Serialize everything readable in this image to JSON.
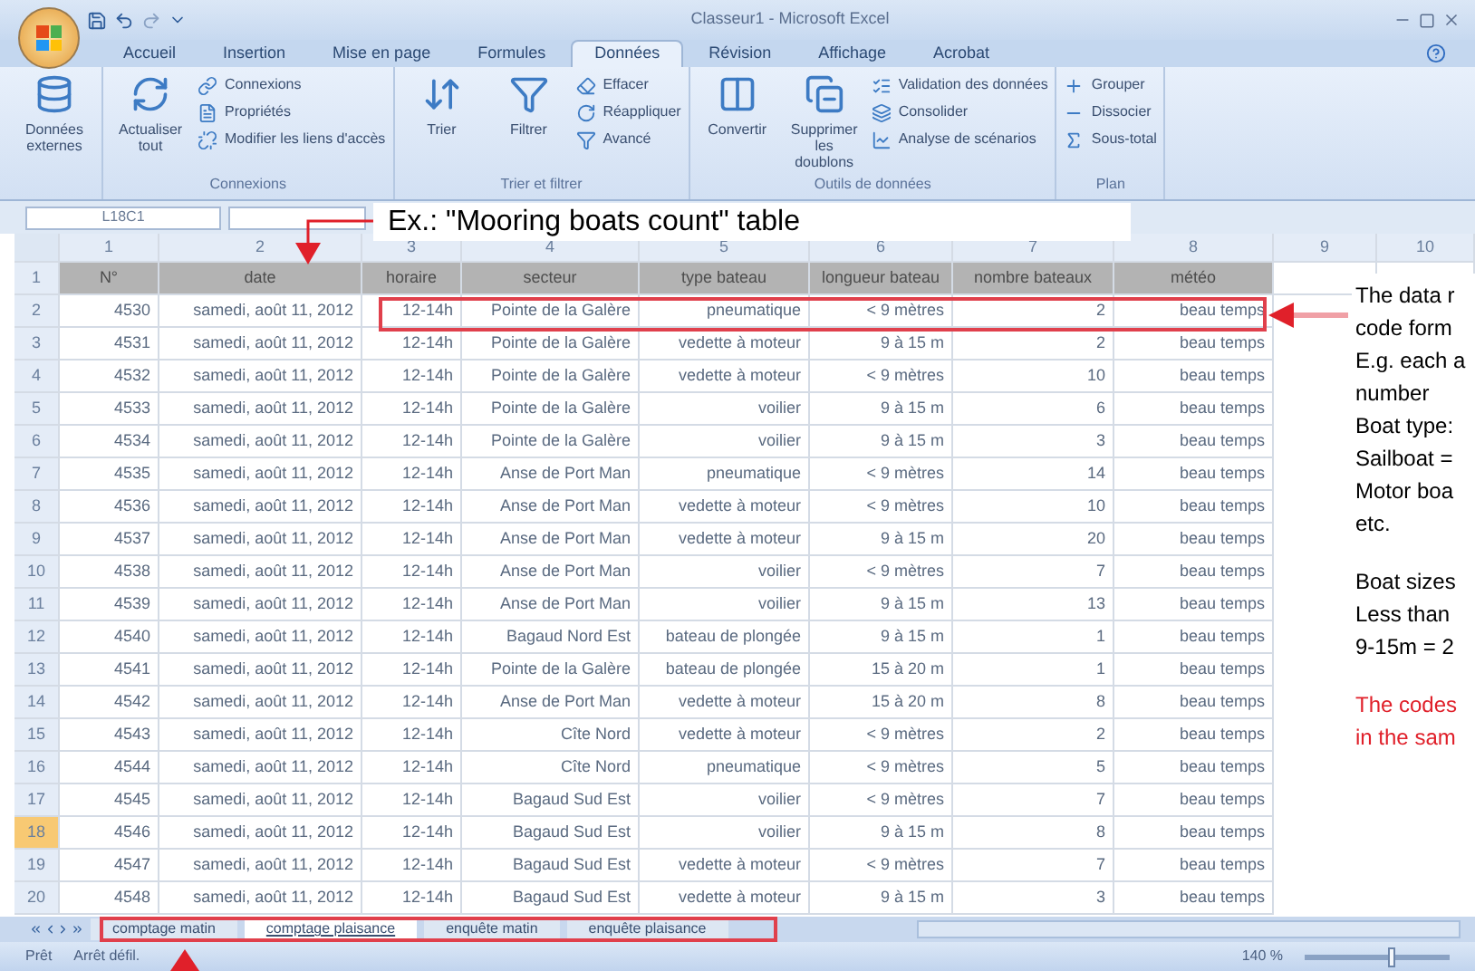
{
  "window": {
    "title": "Classeur1 - Microsoft Excel"
  },
  "ribbon_tabs": [
    {
      "label": "Accueil",
      "selected": false
    },
    {
      "label": "Insertion",
      "selected": false
    },
    {
      "label": "Mise en page",
      "selected": false
    },
    {
      "label": "Formules",
      "selected": false
    },
    {
      "label": "Données",
      "selected": true
    },
    {
      "label": "Révision",
      "selected": false
    },
    {
      "label": "Affichage",
      "selected": false
    },
    {
      "label": "Acrobat",
      "selected": false
    }
  ],
  "ribbon_groups": [
    {
      "large": [
        "Données externes"
      ]
    },
    {
      "label": "Connexions",
      "large": [
        "Actualiser tout"
      ],
      "small": [
        "Connexions",
        "Propriétés",
        "Modifier les liens d'accès"
      ]
    },
    {
      "label": "Trier et filtrer",
      "large": [
        "Trier",
        "Filtrer"
      ],
      "small": [
        "Effacer",
        "Réappliquer",
        "Avancé"
      ]
    },
    {
      "label": "Outils de données",
      "large": [
        "Convertir",
        "Supprimer les doublons"
      ],
      "small": [
        "Validation des données",
        "Consolider",
        "Analyse de scénarios"
      ]
    },
    {
      "label": "Plan",
      "small": [
        "Grouper",
        "Dissocier",
        "Sous-total"
      ]
    }
  ],
  "formula_bar": {
    "name_box": "L18C1"
  },
  "callout": "Ex.: \"Mooring boats count\" table",
  "sheet": {
    "column_headers": [
      "1",
      "2",
      "3",
      "4",
      "5",
      "6",
      "7",
      "8",
      "9",
      "10"
    ],
    "header_row": {
      "number": "1",
      "cells": [
        "N°",
        "date",
        "horaire",
        "secteur",
        "type bateau",
        "longueur bateau",
        "nombre bateaux",
        "météo"
      ]
    },
    "rows": [
      {
        "number": "2",
        "selected": false,
        "cells": [
          "4530",
          "samedi, août 11, 2012",
          "12-14h",
          "Pointe de la Galère",
          "pneumatique",
          "< 9 mètres",
          "2",
          "beau temps"
        ]
      },
      {
        "number": "3",
        "selected": false,
        "cells": [
          "4531",
          "samedi, août 11, 2012",
          "12-14h",
          "Pointe de la Galère",
          "vedette à moteur",
          "9 à 15 m",
          "2",
          "beau temps"
        ]
      },
      {
        "number": "4",
        "selected": false,
        "cells": [
          "4532",
          "samedi, août 11, 2012",
          "12-14h",
          "Pointe de la Galère",
          "vedette à moteur",
          "< 9 mètres",
          "10",
          "beau temps"
        ]
      },
      {
        "number": "5",
        "selected": false,
        "cells": [
          "4533",
          "samedi, août 11, 2012",
          "12-14h",
          "Pointe de la Galère",
          "voilier",
          "9 à 15 m",
          "6",
          "beau temps"
        ]
      },
      {
        "number": "6",
        "selected": false,
        "cells": [
          "4534",
          "samedi, août 11, 2012",
          "12-14h",
          "Pointe de la Galère",
          "voilier",
          "9 à 15 m",
          "3",
          "beau temps"
        ]
      },
      {
        "number": "7",
        "selected": false,
        "cells": [
          "4535",
          "samedi, août 11, 2012",
          "12-14h",
          "Anse de Port Man",
          "pneumatique",
          "< 9 mètres",
          "14",
          "beau temps"
        ]
      },
      {
        "number": "8",
        "selected": false,
        "cells": [
          "4536",
          "samedi, août 11, 2012",
          "12-14h",
          "Anse de Port Man",
          "vedette à moteur",
          "< 9 mètres",
          "10",
          "beau temps"
        ]
      },
      {
        "number": "9",
        "selected": false,
        "cells": [
          "4537",
          "samedi, août 11, 2012",
          "12-14h",
          "Anse de Port Man",
          "vedette à moteur",
          "9 à 15 m",
          "20",
          "beau temps"
        ]
      },
      {
        "number": "10",
        "selected": false,
        "cells": [
          "4538",
          "samedi, août 11, 2012",
          "12-14h",
          "Anse de Port Man",
          "voilier",
          "< 9 mètres",
          "7",
          "beau temps"
        ]
      },
      {
        "number": "11",
        "selected": false,
        "cells": [
          "4539",
          "samedi, août 11, 2012",
          "12-14h",
          "Anse de Port Man",
          "voilier",
          "9 à 15 m",
          "13",
          "beau temps"
        ]
      },
      {
        "number": "12",
        "selected": false,
        "cells": [
          "4540",
          "samedi, août 11, 2012",
          "12-14h",
          "Bagaud Nord Est",
          "bateau de plongée",
          "9 à 15 m",
          "1",
          "beau temps"
        ]
      },
      {
        "number": "13",
        "selected": false,
        "cells": [
          "4541",
          "samedi, août 11, 2012",
          "12-14h",
          "Pointe de la Galère",
          "bateau de plongée",
          "15 à 20 m",
          "1",
          "beau temps"
        ]
      },
      {
        "number": "14",
        "selected": false,
        "cells": [
          "4542",
          "samedi, août 11, 2012",
          "12-14h",
          "Anse de Port Man",
          "vedette à moteur",
          "15 à 20 m",
          "8",
          "beau temps"
        ]
      },
      {
        "number": "15",
        "selected": false,
        "cells": [
          "4543",
          "samedi, août 11, 2012",
          "12-14h",
          "Cîte Nord",
          "vedette à moteur",
          "< 9 mètres",
          "2",
          "beau temps"
        ]
      },
      {
        "number": "16",
        "selected": false,
        "cells": [
          "4544",
          "samedi, août 11, 2012",
          "12-14h",
          "Cîte Nord",
          "pneumatique",
          "< 9 mètres",
          "5",
          "beau temps"
        ]
      },
      {
        "number": "17",
        "selected": false,
        "cells": [
          "4545",
          "samedi, août 11, 2012",
          "12-14h",
          "Bagaud Sud Est",
          "voilier",
          "< 9 mètres",
          "7",
          "beau temps"
        ]
      },
      {
        "number": "18",
        "selected": true,
        "cells": [
          "4546",
          "samedi, août 11, 2012",
          "12-14h",
          "Bagaud Sud Est",
          "voilier",
          "9 à 15 m",
          "8",
          "beau temps"
        ]
      },
      {
        "number": "19",
        "selected": false,
        "cells": [
          "4547",
          "samedi, août 11, 2012",
          "12-14h",
          "Bagaud Sud Est",
          "vedette à moteur",
          "< 9 mètres",
          "7",
          "beau temps"
        ]
      },
      {
        "number": "20",
        "selected": false,
        "cells": [
          "4548",
          "samedi, août 11, 2012",
          "12-14h",
          "Bagaud Sud Est",
          "vedette à moteur",
          "9 à 15 m",
          "3",
          "beau temps"
        ]
      }
    ]
  },
  "notes": [
    {
      "kind": "plain",
      "lines": [
        "The data r",
        "code form",
        "E.g. each a",
        "number",
        "Boat type:",
        "Sailboat =",
        "Motor boa",
        "etc."
      ]
    },
    {
      "kind": "plain",
      "lines": [
        "Boat sizes",
        "Less than",
        "9-15m = 2"
      ]
    },
    {
      "kind": "warning",
      "lines": [
        "The codes",
        "in the sam"
      ]
    }
  ],
  "sheet_tabs": [
    {
      "label": "comptage matin",
      "selected": false
    },
    {
      "label": "comptage plaisance",
      "selected": true
    },
    {
      "label": "enquête matin",
      "selected": false
    },
    {
      "label": "enquête plaisance",
      "selected": false
    }
  ],
  "status_bar": {
    "items": [
      "Prêt",
      "Arrêt défil."
    ],
    "zoom": "140 %",
    "zoom_slider": {
      "level": 0.6
    }
  }
}
